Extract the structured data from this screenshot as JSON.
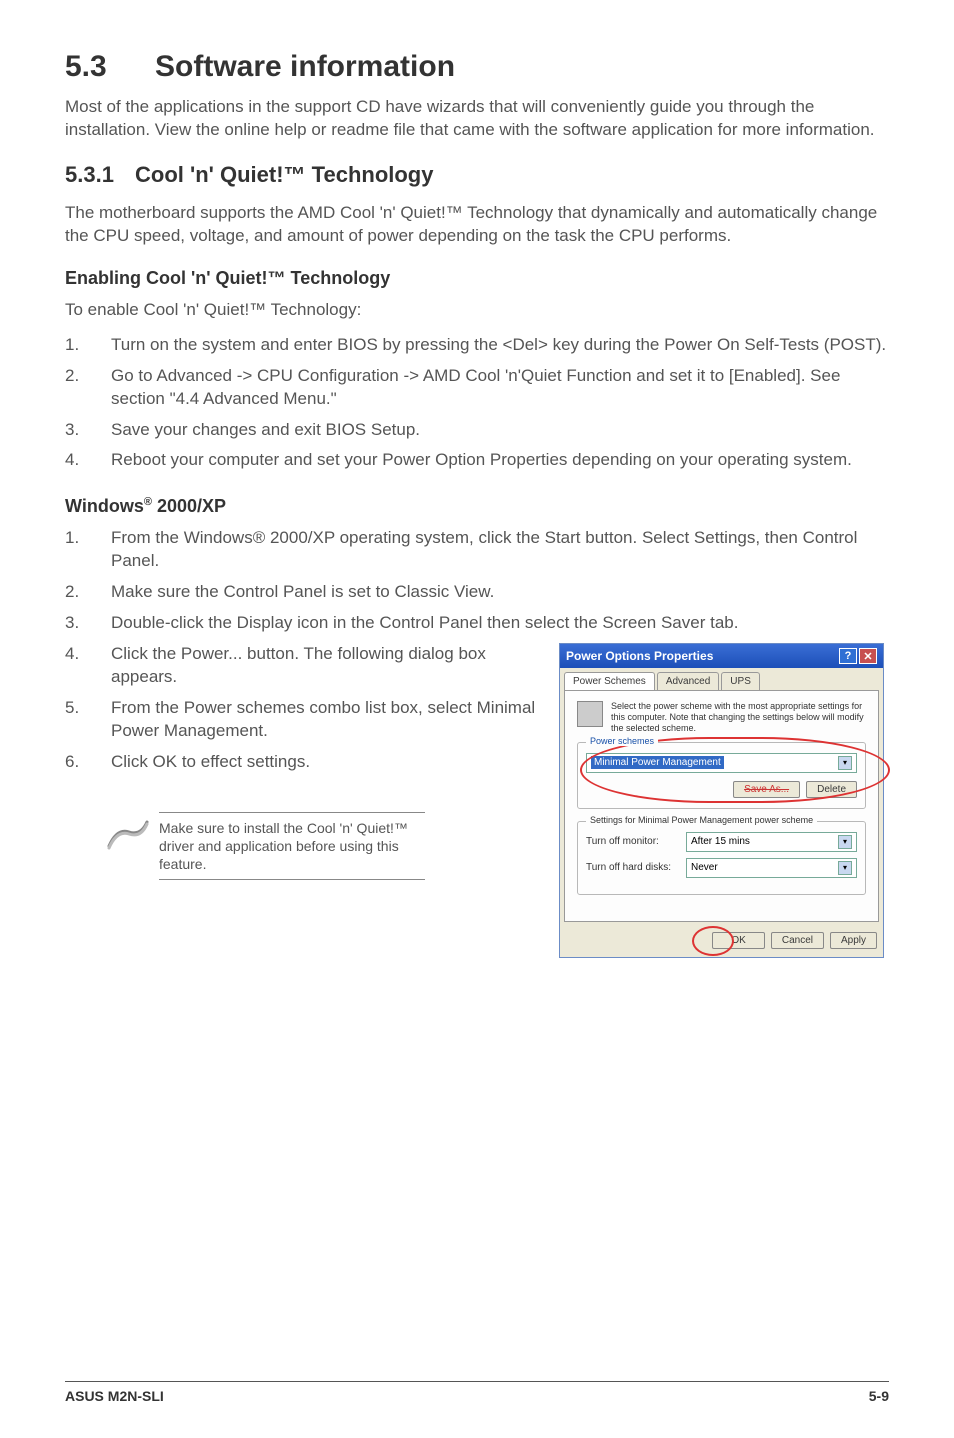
{
  "heading": {
    "num": "5.3",
    "title": "Software information"
  },
  "intro": "Most of the applications in the support CD have wizards that will conveniently guide you through the installation. View the online help or readme file that came with the software application for more information.",
  "sub": {
    "num": "5.3.1",
    "title": "Cool 'n' Quiet!™ Technology"
  },
  "sub_desc": "The motherboard supports the AMD Cool 'n' Quiet!™ Technology that dynamically and automatically change the CPU speed, voltage, and amount of power depending on the task the CPU performs.",
  "enabling": {
    "title": "Enabling Cool 'n' Quiet!™ Technology",
    "lead": "To enable Cool 'n' Quiet!™ Technology:"
  },
  "steps1": [
    "Turn on the system and enter BIOS by pressing the <Del> key during the Power On Self-Tests (POST).",
    "Go to Advanced -> CPU Configuration -> AMD Cool 'n'Quiet Function and set it to [Enabled]. See section \"4.4 Advanced Menu.\"",
    "Save your changes and exit  BIOS Setup.",
    "Reboot your computer and set your Power Option Properties depending on your operating system."
  ],
  "winhead": {
    "prefix": "Windows",
    "suffix": " 2000/XP"
  },
  "steps2": [
    "From the Windows® 2000/XP operating system, click the Start button. Select Settings, then Control Panel.",
    "Make sure the Control Panel is set to Classic View.",
    "Double-click the Display icon in the Control Panel then select the Screen Saver tab.",
    "Click the Power... button. The following dialog box appears.",
    "From the Power schemes combo list box, select Minimal Power Management.",
    "Click OK to effect settings."
  ],
  "dialog": {
    "title": "Power Options Properties",
    "tabs": [
      "Power Schemes",
      "Advanced",
      "UPS"
    ],
    "desc": "Select the power scheme with the most appropriate settings for this computer. Note that changing the settings below will modify the selected scheme.",
    "schemes_legend": "Power schemes",
    "scheme_value": "Minimal Power Management",
    "save_as": "Save As...",
    "delete": "Delete",
    "settings_label": "Settings for Minimal Power Management power scheme",
    "monitor_label": "Turn off monitor:",
    "monitor_value": "After 15 mins",
    "disks_label": "Turn off hard disks:",
    "disks_value": "Never",
    "ok": "OK",
    "cancel": "Cancel",
    "apply": "Apply"
  },
  "note": "Make sure to install the Cool 'n' Quiet!™ driver and application before using this feature.",
  "footer": {
    "left": "ASUS M2N-SLI",
    "right": "5-9"
  }
}
